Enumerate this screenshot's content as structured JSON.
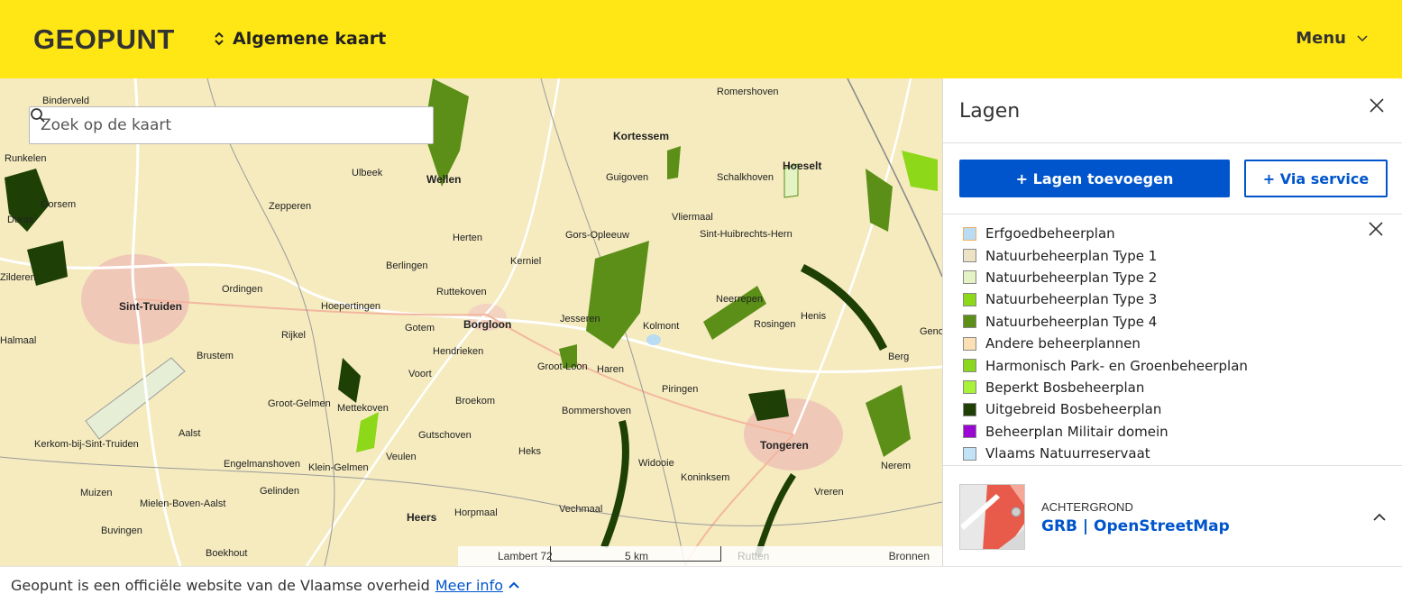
{
  "header": {
    "logo": "GEOPUNT",
    "map_selector": "Algemene kaart",
    "menu_label": "Menu"
  },
  "search": {
    "placeholder": "Zoek op de kaart"
  },
  "map": {
    "places": [
      {
        "name": "Binderveld",
        "bold": false
      },
      {
        "name": "Romershoven",
        "bold": false
      },
      {
        "name": "Kortessem",
        "bold": true
      },
      {
        "name": "Runkelen",
        "bold": false
      },
      {
        "name": "Ulbeek",
        "bold": false
      },
      {
        "name": "Wellen",
        "bold": true
      },
      {
        "name": "Guigoven",
        "bold": false
      },
      {
        "name": "Schalkhoven",
        "bold": false
      },
      {
        "name": "Hoeselt",
        "bold": true
      },
      {
        "name": "Gorsem",
        "bold": false
      },
      {
        "name": "Zepperen",
        "bold": false
      },
      {
        "name": "Duras",
        "bold": false
      },
      {
        "name": "Vliermaal",
        "bold": false
      },
      {
        "name": "Herten",
        "bold": false
      },
      {
        "name": "Gors-Opleeuw",
        "bold": false
      },
      {
        "name": "Sint-Huibrechts-Hern",
        "bold": false
      },
      {
        "name": "Berlingen",
        "bold": false
      },
      {
        "name": "Kerniel",
        "bold": false
      },
      {
        "name": "Zilderen",
        "bold": false
      },
      {
        "name": "Ordingen",
        "bold": false
      },
      {
        "name": "Ruttekoven",
        "bold": false
      },
      {
        "name": "Neerrepen",
        "bold": false
      },
      {
        "name": "Sint-Truiden",
        "bold": true
      },
      {
        "name": "Hoepertingen",
        "bold": false
      },
      {
        "name": "Gotem",
        "bold": false
      },
      {
        "name": "Borgloon",
        "bold": true
      },
      {
        "name": "Jesseren",
        "bold": false
      },
      {
        "name": "Kolmont",
        "bold": false
      },
      {
        "name": "Rosingen",
        "bold": false
      },
      {
        "name": "Henis",
        "bold": false
      },
      {
        "name": "Halmaal",
        "bold": false
      },
      {
        "name": "Rijkel",
        "bold": false
      },
      {
        "name": "Hendrieken",
        "bold": false
      },
      {
        "name": "Brustem",
        "bold": false
      },
      {
        "name": "Voort",
        "bold": false
      },
      {
        "name": "Groot-Loon",
        "bold": false
      },
      {
        "name": "Haren",
        "bold": false
      },
      {
        "name": "Berg",
        "bold": false
      },
      {
        "name": "Piringen",
        "bold": false
      },
      {
        "name": "Groot-Gelmen",
        "bold": false
      },
      {
        "name": "Mettekoven",
        "bold": false
      },
      {
        "name": "Broekom",
        "bold": false
      },
      {
        "name": "Bommershoven",
        "bold": false
      },
      {
        "name": "Aalst",
        "bold": false
      },
      {
        "name": "Gutschoven",
        "bold": false
      },
      {
        "name": "Tongeren",
        "bold": true
      },
      {
        "name": "Kerkom-bij-Sint-Truiden",
        "bold": false
      },
      {
        "name": "Heks",
        "bold": false
      },
      {
        "name": "Veulen",
        "bold": false
      },
      {
        "name": "Widooie",
        "bold": false
      },
      {
        "name": "Engelmanshoven",
        "bold": false
      },
      {
        "name": "Klein-Gelmen",
        "bold": false
      },
      {
        "name": "Koninksem",
        "bold": false
      },
      {
        "name": "Nerem",
        "bold": false
      },
      {
        "name": "Muizen",
        "bold": false
      },
      {
        "name": "Gelinden",
        "bold": false
      },
      {
        "name": "Vreren",
        "bold": false
      },
      {
        "name": "Mielen-Boven-Aalst",
        "bold": false
      },
      {
        "name": "Vechmaal",
        "bold": false
      },
      {
        "name": "Horpmaal",
        "bold": false
      },
      {
        "name": "Heers",
        "bold": true
      },
      {
        "name": "Buvingen",
        "bold": false
      },
      {
        "name": "Boekhout",
        "bold": false
      },
      {
        "name": "Genoelselderen",
        "bold": false
      }
    ],
    "scale": {
      "projection": "Lambert 72",
      "distance": "5 km",
      "sources": "Bronnen",
      "faded_place": "Rutten"
    }
  },
  "panel": {
    "title": "Lagen",
    "add_layers": "+ Lagen toevoegen",
    "via_service": "+ Via service",
    "legend": [
      {
        "label": "Erfgoedbeheerplan",
        "color": "#b9dbf3"
      },
      {
        "label": "Natuurbeheerplan Type 1",
        "color": "#ece2c4"
      },
      {
        "label": "Natuurbeheerplan Type 2",
        "color": "#e3f3c4"
      },
      {
        "label": "Natuurbeheerplan Type 3",
        "color": "#8ed81a"
      },
      {
        "label": "Natuurbeheerplan Type 4",
        "color": "#5c8f17"
      },
      {
        "label": "Andere beheerplannen",
        "color": "#fbe0b6"
      },
      {
        "label": "Harmonisch Park- en Groenbeheerplan",
        "color": "#8bd61e"
      },
      {
        "label": "Beperkt Bosbeheerplan",
        "color": "#a8f23a"
      },
      {
        "label": "Uitgebreid Bosbeheerplan",
        "color": "#1e3f06"
      },
      {
        "label": "Beheerplan Militair domein",
        "color": "#9b08d4"
      },
      {
        "label": "Vlaams Natuurreservaat",
        "color": "#c2e2f5"
      }
    ],
    "background": {
      "label": "ACHTERGROND",
      "value": "GRB | OpenStreetMap"
    }
  },
  "footer": {
    "text": "Geopunt is een officiële website van de Vlaamse overheid",
    "link": "Meer info"
  }
}
